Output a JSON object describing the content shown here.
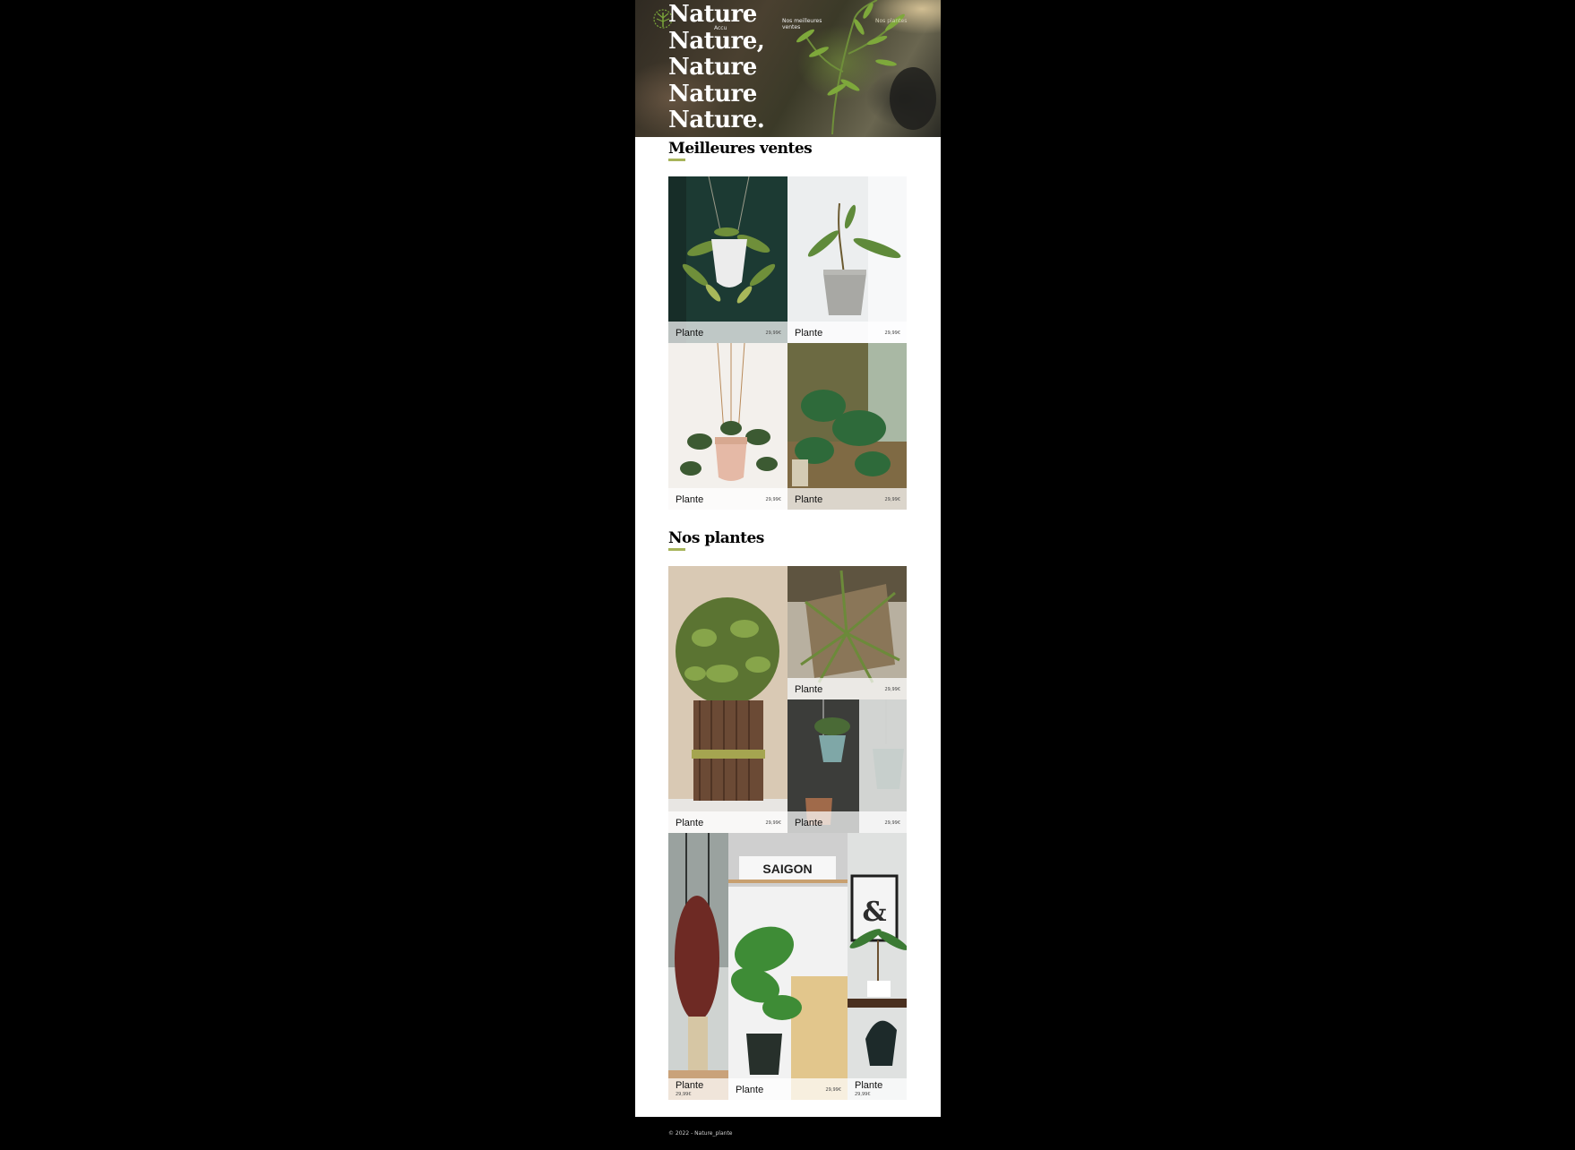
{
  "header": {
    "title_lines": [
      "Nature",
      "Nature,",
      "Nature",
      "Nature",
      "Nature."
    ],
    "logo_caption": "Accu",
    "nav": [
      {
        "label": "Nos meilleures ventes"
      },
      {
        "label": "Nos plantes"
      }
    ]
  },
  "best_sellers": {
    "title": "Meilleures ventes",
    "items": [
      {
        "name": "Plante",
        "price": "29,99€"
      },
      {
        "name": "Plante",
        "price": "29,99€"
      },
      {
        "name": "Plante",
        "price": "29,99€"
      },
      {
        "name": "Plante",
        "price": "29,99€"
      }
    ]
  },
  "our_plants": {
    "title": "Nos plantes",
    "items": [
      {
        "name": "Plante",
        "price": "29,99€"
      },
      {
        "name": "Plante",
        "price": "29,99€"
      },
      {
        "name": "Plante",
        "price": "29,99€"
      },
      {
        "name": "Plante",
        "price": "29,99€"
      },
      {
        "name": "Plante",
        "price": "29,99€"
      },
      {
        "name": "Plante",
        "price": "29,99€"
      }
    ],
    "poster_text": "SAIGON",
    "poster_symbol": "&"
  },
  "footer": {
    "text": "© 2022 - Nature_plante"
  }
}
